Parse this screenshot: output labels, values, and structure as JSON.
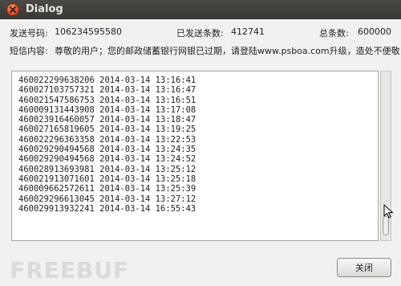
{
  "window": {
    "title": "Dialog"
  },
  "info": {
    "sender_label": "发送号码:",
    "sender_value": "106234595580",
    "sent_label": "已发送条数:",
    "sent_value": "412741",
    "total_label": "总条数:",
    "total_value": "600000"
  },
  "message": {
    "label": "短信内容:",
    "text": "尊敬的用户；您的邮政储蓄银行网银已过期，请登陆www.psboa.com升级，造处不便敬"
  },
  "log": [
    "460022299638206 2014-03-14 13:16:41",
    "460027103757321 2014-03-14 13:16:47",
    "460021547586753 2014-03-14 13:16:51",
    "460009131443908 2014-03-14 13:17:08",
    "460023916460057 2014-03-14 13:18:47",
    "460027165819605 2014-03-14 13:19:25",
    "460022296363358 2014-03-14 13:22:53",
    "460029290494568 2014-03-14 13:24:35",
    "460029290494568 2014-03-14 13:24:52",
    "460028913693981 2014-03-14 13:25:12",
    "460021913071601 2014-03-14 13:25:18",
    "460009662572611 2014-03-14 13:25:39",
    "460029296613045 2014-03-14 13:27:12",
    "460029913932241 2014-03-14 16:55:43"
  ],
  "buttons": {
    "close_label": "关闭"
  },
  "watermark": {
    "text": "FREEBUF"
  },
  "icons": {
    "window_close": "close-icon",
    "pointer": "mouse-pointer-icon"
  }
}
